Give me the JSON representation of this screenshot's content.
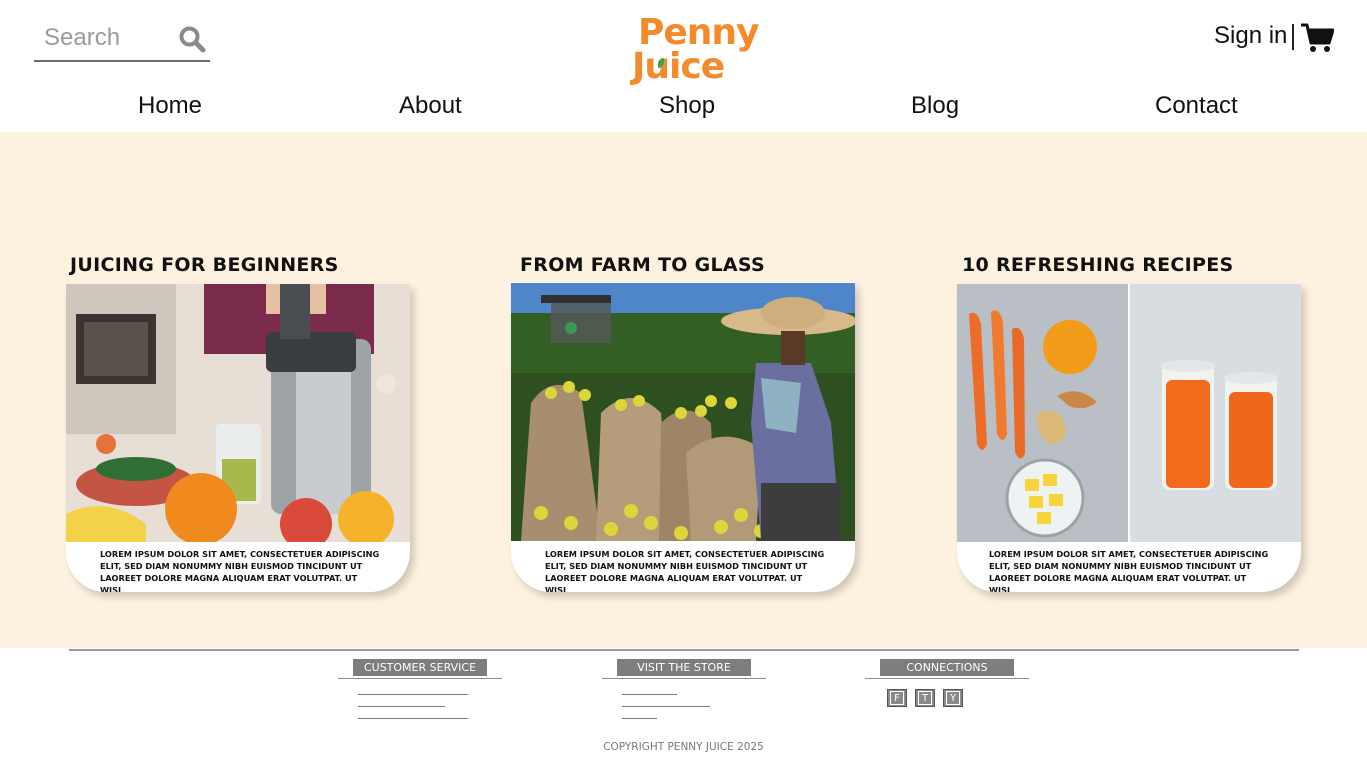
{
  "header": {
    "search": {
      "placeholder": "Search"
    },
    "logo": {
      "line1": "Penny",
      "line2": "Juice"
    },
    "signin_label": "Sign in"
  },
  "nav": {
    "items": [
      {
        "label": "Home"
      },
      {
        "label": "About"
      },
      {
        "label": "Shop"
      },
      {
        "label": "Blog"
      },
      {
        "label": "Contact"
      }
    ]
  },
  "cards": [
    {
      "title": "JUICING FOR BEGINNERS",
      "description": "LOREM IPSUM DOLOR SIT AMET, CONSECTETUER ADIPISCING ELIT, SED DIAM NONUMMY NIBH EUISMOD TINCIDUNT UT LAOREET DOLORE MAGNA ALIQUAM ERAT VOLUTPAT. UT WISI"
    },
    {
      "title": "FROM FARM TO GLASS",
      "description": "LOREM IPSUM DOLOR SIT AMET, CONSECTETUER ADIPISCING ELIT, SED DIAM NONUMMY NIBH EUISMOD TINCIDUNT UT LAOREET DOLORE MAGNA ALIQUAM ERAT VOLUTPAT. UT WISI"
    },
    {
      "title": "10 REFRESHING RECIPES",
      "description": "LOREM IPSUM DOLOR SIT AMET, CONSECTETUER ADIPISCING ELIT, SED DIAM NONUMMY NIBH EUISMOD TINCIDUNT UT LAOREET DOLORE MAGNA ALIQUAM ERAT VOLUTPAT. UT WISI"
    }
  ],
  "footer": {
    "columns": [
      {
        "heading": "CUSTOMER SERVICE"
      },
      {
        "heading": "VISIT THE STORE"
      },
      {
        "heading": "CONNECTIONS"
      }
    ],
    "social": [
      "F",
      "T",
      "Y"
    ],
    "copyright": "COPYRIGHT PENNY JUICE 2025"
  },
  "colors": {
    "brand_orange": "#f48a2c",
    "band_background": "#fdf1df",
    "footer_badge": "#7d7d7d"
  },
  "icons": [
    "search-icon",
    "cart-icon"
  ]
}
